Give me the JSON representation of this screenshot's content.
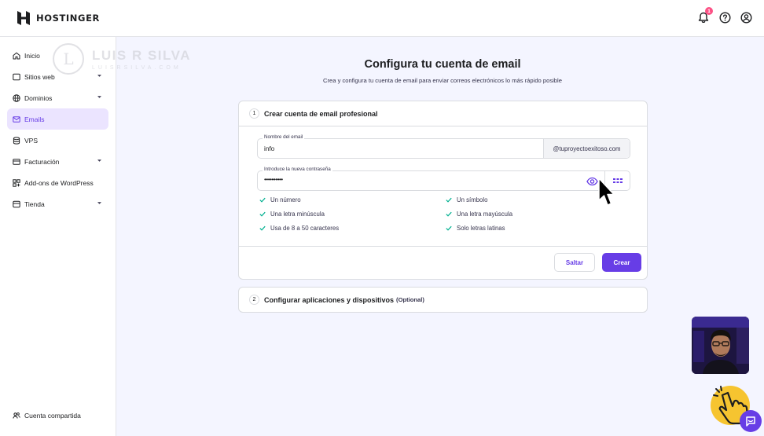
{
  "brand": {
    "name": "HOSTINGER"
  },
  "header": {
    "notification_count": "1"
  },
  "sidebar": {
    "items": [
      {
        "label": "Inicio",
        "icon": "home-icon",
        "has_chevron": false,
        "active": false
      },
      {
        "label": "Sitios web",
        "icon": "website-icon",
        "has_chevron": true,
        "active": false
      },
      {
        "label": "Dominios",
        "icon": "globe-icon",
        "has_chevron": true,
        "active": false
      },
      {
        "label": "Emails",
        "icon": "mail-icon",
        "has_chevron": false,
        "active": true
      },
      {
        "label": "VPS",
        "icon": "server-icon",
        "has_chevron": false,
        "active": false
      },
      {
        "label": "Facturación",
        "icon": "billing-icon",
        "has_chevron": true,
        "active": false
      },
      {
        "label": "Add-ons de WordPress",
        "icon": "addons-icon",
        "has_chevron": false,
        "active": false
      },
      {
        "label": "Tienda",
        "icon": "store-icon",
        "has_chevron": true,
        "active": false
      }
    ],
    "shared_account": "Cuenta compartida"
  },
  "watermark": {
    "initial": "L",
    "name": "LUIS R SILVA",
    "url": "LUISRSILVA.COM"
  },
  "main": {
    "title": "Configura tu cuenta de email",
    "subtitle": "Crea y configura tu cuenta de email para enviar correos electrónicos lo más rápido posible"
  },
  "step1": {
    "number": "1",
    "title": "Crear cuenta de email profesional",
    "email_label": "Nombre del email",
    "email_value": "info",
    "domain_suffix": "@tuproyectoexitoso.com",
    "password_label": "Introduce la nueva contraseña",
    "password_value": "••••••••••",
    "requirements_left": [
      "Un número",
      "Una letra minúscula",
      "Usa de 8 a 50 caracteres"
    ],
    "requirements_right": [
      "Un símbolo",
      "Una letra mayúscula",
      "Solo letras latinas"
    ],
    "skip_label": "Saltar",
    "create_label": "Crear"
  },
  "step2": {
    "number": "2",
    "title": "Configurar aplicaciones y dispositivos",
    "optional": "(Optional)"
  },
  "colors": {
    "accent": "#673de6",
    "accent_light": "#ebe4ff",
    "success": "#00b090",
    "badge": "#fc5185"
  }
}
